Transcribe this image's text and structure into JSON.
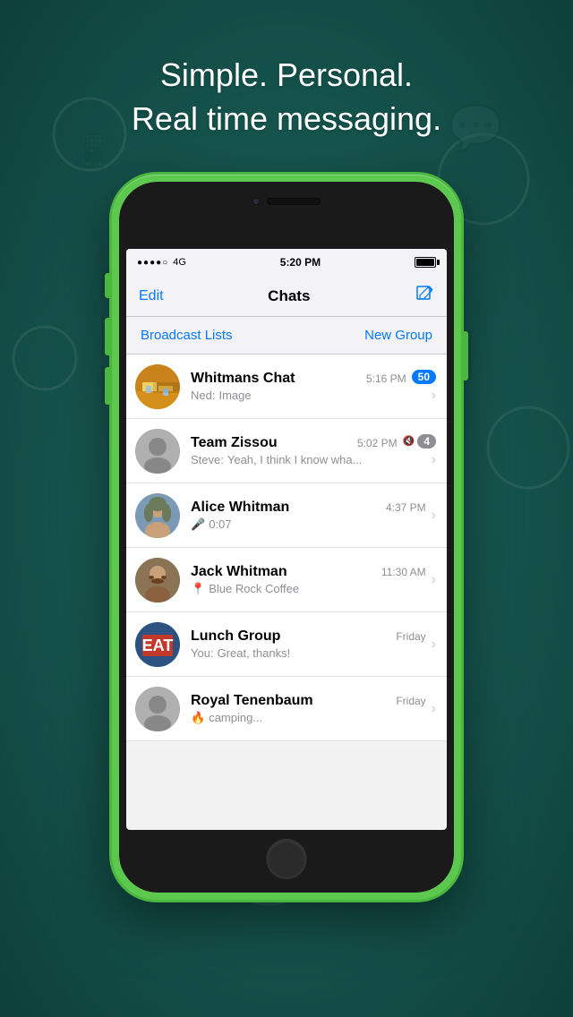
{
  "background": {
    "tagline_line1": "Simple. Personal.",
    "tagline_line2": "Real time messaging."
  },
  "status_bar": {
    "signal": "●●●●○ 4G",
    "time": "5:20 PM",
    "battery": "full"
  },
  "nav": {
    "edit": "Edit",
    "title": "Chats",
    "compose_icon": "✏"
  },
  "actions": {
    "broadcast": "Broadcast Lists",
    "new_group": "New Group"
  },
  "chats": [
    {
      "id": "whitmans",
      "name": "Whitmans Chat",
      "time": "5:16 PM",
      "sender": "Ned:",
      "preview": "Image",
      "badge": "50",
      "muted": false,
      "preview_icon": ""
    },
    {
      "id": "zissou",
      "name": "Team Zissou",
      "time": "5:02 PM",
      "sender": "Steve:",
      "preview": "Yeah, I think I know wha...",
      "badge": "4",
      "muted": true,
      "preview_icon": ""
    },
    {
      "id": "alice",
      "name": "Alice Whitman",
      "time": "4:37 PM",
      "sender": "",
      "preview": "0:07",
      "badge": "",
      "muted": false,
      "preview_icon": "mic"
    },
    {
      "id": "jack",
      "name": "Jack Whitman",
      "time": "11:30 AM",
      "sender": "",
      "preview": "Blue Rock Coffee",
      "badge": "",
      "muted": false,
      "preview_icon": "location"
    },
    {
      "id": "lunch",
      "name": "Lunch Group",
      "time": "Friday",
      "sender": "You:",
      "preview": "Great, thanks!",
      "badge": "",
      "muted": false,
      "preview_icon": ""
    },
    {
      "id": "royal",
      "name": "Royal Tenenbaum",
      "time": "Friday",
      "sender": "",
      "preview": "camping...",
      "badge": "",
      "muted": false,
      "preview_icon": "fire"
    }
  ]
}
